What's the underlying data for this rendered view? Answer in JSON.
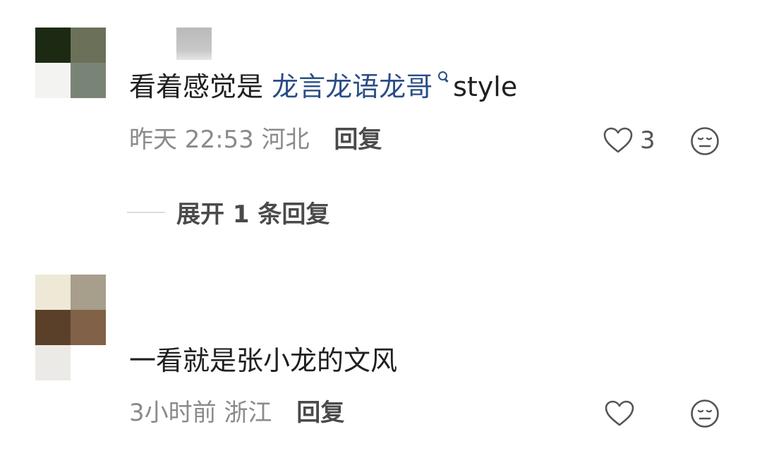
{
  "comments": [
    {
      "avatar_colors": [
        "#1d2a13",
        "#6b7158",
        "#f3f3f1",
        "#7a8476"
      ],
      "text_prefix": "看着感觉是 ",
      "tag_text": "龙言龙语龙哥",
      "text_suffix": "style",
      "time": "昨天 22:53",
      "location": "河北",
      "reply_label": "回复",
      "like_count": "3",
      "expand_label": "展开 1 条回复"
    },
    {
      "avatar_colors": [
        "#eee8d7",
        "#a79e8c",
        "#5a4029",
        "#816147",
        "#eceae6",
        "#ffffff"
      ],
      "text": "一看就是张小龙的文风",
      "time": "3小时前",
      "location": "浙江",
      "reply_label": "回复"
    }
  ]
}
